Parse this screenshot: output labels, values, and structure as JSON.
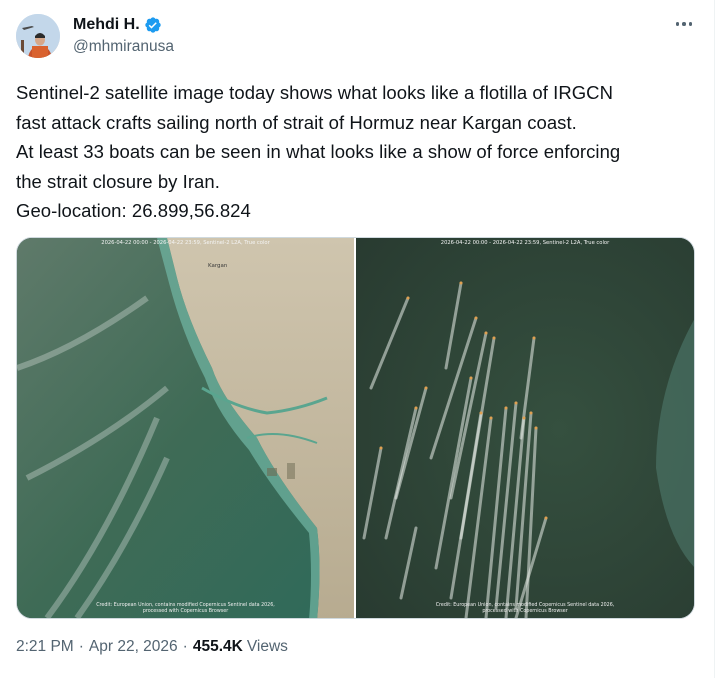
{
  "author": {
    "name": "Mehdi H.",
    "handle": "@mhmiranusa",
    "verified": true,
    "verified_color": "#1d9bf0"
  },
  "icons": {
    "more": "more-horizontal-icon",
    "verified": "verified-badge-icon"
  },
  "tweet": {
    "lines": [
      "Sentinel-2 satellite image today shows what looks like a flotilla of IRGCN",
      "fast attack crafts sailing north of strait of Hormuz near Kargan coast.",
      "At least 33 boats can be seen in what looks like a show of force enforcing",
      "the strait closure by Iran.",
      "Geo-location: 26.899,56.824"
    ]
  },
  "media": {
    "left": {
      "caption_top": "2026-04-22 00:00 - 2026-04-22 23:59, Sentinel-2 L2A, True color",
      "town_label": "Kargan",
      "caption_bottom": "Credit: European Union, contains modified Copernicus Sentinel data 2026, processed with Copernicus Browser"
    },
    "right": {
      "caption_top": "2026-04-22 00:00 - 2026-04-22 23:59, Sentinel-2 L2A, True color",
      "caption_bottom": "Credit: European Union, contains modified Copernicus Sentinel data 2026, processed with Copernicus Browser"
    }
  },
  "meta": {
    "time": "2:21 PM",
    "separator": "·",
    "date": "Apr 22, 2026",
    "views_count": "455.4K",
    "views_label": "Views"
  },
  "colors": {
    "text": "#0f1419",
    "secondary": "#536471",
    "border": "#cfd9de"
  }
}
